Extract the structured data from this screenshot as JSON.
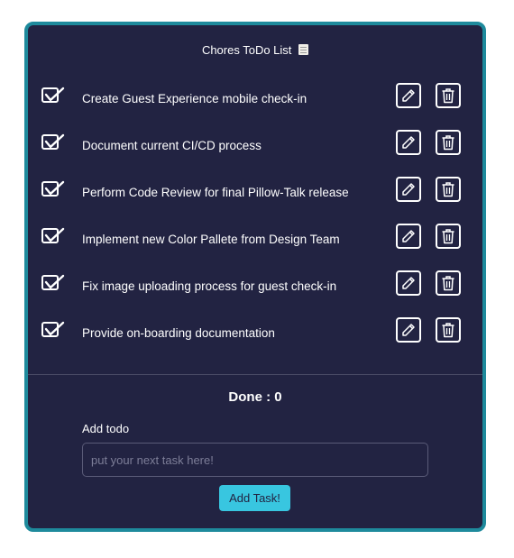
{
  "header": {
    "title": "Chores ToDo List",
    "title_icon": "scroll-icon"
  },
  "todos": [
    {
      "text": "Create Guest Experience mobile check-in",
      "done": false
    },
    {
      "text": "Document current CI/CD process",
      "done": false
    },
    {
      "text": "Perform Code Review for final Pillow-Talk release",
      "done": false
    },
    {
      "text": "Implement new Color Pallete from Design Team",
      "done": false
    },
    {
      "text": "Fix image uploading process for guest check-in",
      "done": false
    },
    {
      "text": "Provide on-boarding documentation",
      "done": false
    }
  ],
  "row_icons": {
    "check": "check-icon",
    "edit": "pencil-icon",
    "delete": "trash-icon"
  },
  "summary": {
    "done_label": "Done : 0"
  },
  "add_form": {
    "label": "Add todo",
    "placeholder": "put your next task here!",
    "value": "",
    "button_label": "Add Task!"
  },
  "colors": {
    "card_bg": "#222342",
    "card_border": "#1e8a9c",
    "accent": "#38c6e0",
    "text": "#ffffff"
  }
}
